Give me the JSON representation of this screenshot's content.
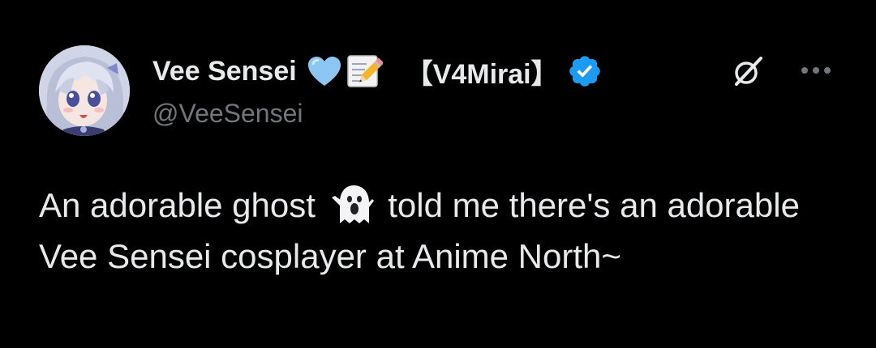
{
  "author": {
    "display_name": "Vee Sensei",
    "name_tag": "【V4Mirai】",
    "username": "@VeeSensei",
    "name_emojis": [
      "blue-heart-icon",
      "memo-icon"
    ],
    "verified": true,
    "verified_color": "#1d9bf0"
  },
  "actions": {
    "grok_icon": "grok-icon",
    "more_icon": "more-options-icon"
  },
  "post": {
    "text_part1": "An adorable ghost",
    "emoji": "ghost-icon",
    "text_part2": "told me there's an adorable Vee Sensei cosplayer at Anime North~"
  },
  "colors": {
    "background": "#000000",
    "primary_text": "#e7e9ea",
    "secondary_text": "#71767b",
    "accent": "#1d9bf0"
  }
}
